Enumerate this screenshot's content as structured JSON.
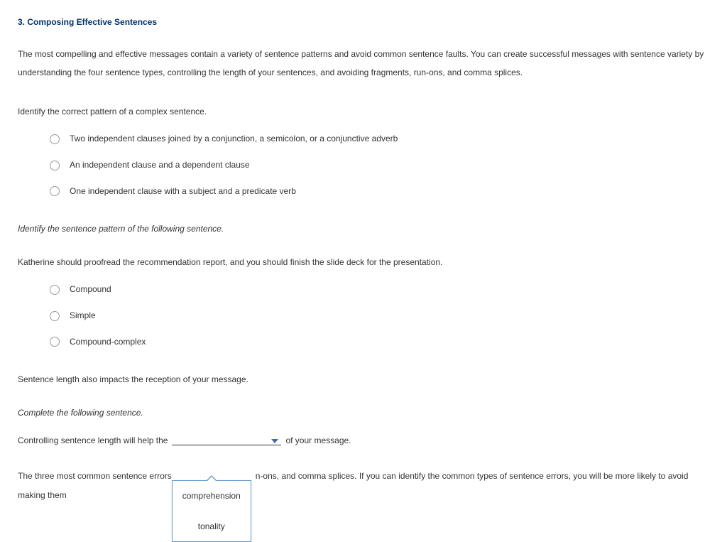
{
  "heading": "3. Composing Effective Sentences",
  "intro": "The most compelling and effective messages contain a variety of sentence patterns and avoid common sentence faults. You can create successful messages with sentence variety by understanding the four sentence types, controlling the length of your sentences, and avoiding fragments, run-ons, and comma splices.",
  "q1": {
    "prompt": "Identify the correct pattern of a complex sentence.",
    "options": [
      "Two independent clauses joined by a conjunction, a semicolon, or a conjunctive adverb",
      "An independent clause and a dependent clause",
      "One independent clause with a subject and a predicate verb"
    ]
  },
  "q2": {
    "prompt": "Identify the sentence pattern of the following sentence.",
    "sentence": "Katherine should proofread the recommendation report, and you should finish the slide deck for the presentation.",
    "options": [
      "Compound",
      "Simple",
      "Compound-complex"
    ]
  },
  "statement": "Sentence length also impacts the reception of your message.",
  "q3": {
    "prompt": "Complete the following sentence.",
    "before": "Controlling sentence length will help the",
    "after": "of your message.",
    "dropdown": [
      "comprehension",
      "tonality"
    ]
  },
  "closing": {
    "part1": "The three most common sentence errors",
    "part2": "n-ons, and comma splices. If you can identify the common types of sentence errors, you will be more likely to avoid making them"
  }
}
